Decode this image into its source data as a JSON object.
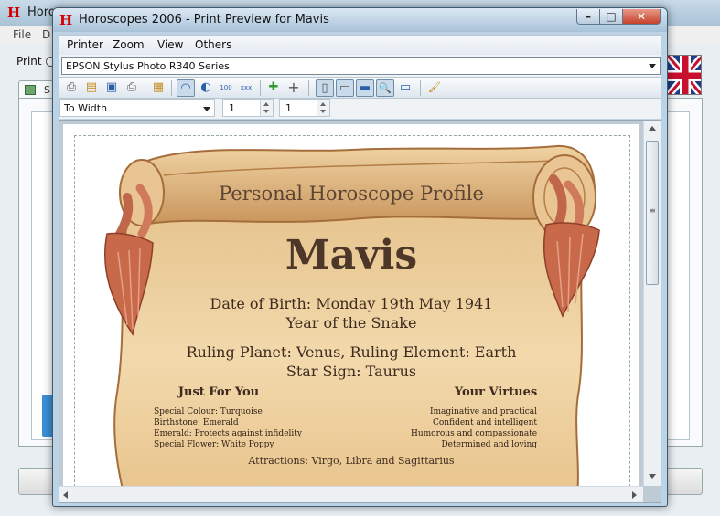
{
  "background_window": {
    "title": "Horo",
    "menu": [
      "File",
      "D"
    ],
    "print_label": "Print",
    "tab_label": "S"
  },
  "window": {
    "title": "Horoscopes 2006 - Print Preview for Mavis",
    "app_logo": "H",
    "controls": {
      "minimize": "–",
      "maximize": "□",
      "close": "✕"
    }
  },
  "menubar": [
    "Printer",
    "Zoom",
    "View",
    "Others"
  ],
  "printer": {
    "selected": "EPSON Stylus Photo R340 Series"
  },
  "toolbar": {
    "buttons": [
      {
        "icon": "print-icon",
        "glyph": "⎙"
      },
      {
        "icon": "export-image-icon",
        "glyph": "▤"
      },
      {
        "icon": "bmp-icon",
        "glyph": "▣"
      },
      {
        "icon": "printer-setup-icon",
        "glyph": "⎙"
      },
      {
        "icon": "page-setup-icon",
        "glyph": "▦"
      },
      {
        "icon": "page-view-icon",
        "glyph": "◠"
      },
      {
        "icon": "zoom-page-icon",
        "glyph": "◐"
      },
      {
        "icon": "zoom-100-icon",
        "glyph": "100"
      },
      {
        "icon": "zoom-custom-icon",
        "glyph": "xxx"
      },
      {
        "icon": "zoom-in-icon",
        "glyph": "✚"
      },
      {
        "icon": "add-icon",
        "glyph": "+"
      },
      {
        "icon": "single-page-icon",
        "glyph": "▯"
      },
      {
        "icon": "two-page-icon",
        "glyph": "▭"
      },
      {
        "icon": "wide-page-icon",
        "glyph": "▬"
      },
      {
        "icon": "magnifier-icon",
        "glyph": "🔍"
      },
      {
        "icon": "fit-icon",
        "glyph": "▭"
      },
      {
        "icon": "paint-roller-icon",
        "glyph": "🖌"
      }
    ]
  },
  "zoom": {
    "mode": "To Width",
    "page_from": "1",
    "page_to": "1"
  },
  "document": {
    "heading": "Personal Horoscope Profile",
    "name": "Mavis",
    "dob": "Date of Birth: Monday 19th May 1941",
    "year": "Year of the Snake",
    "ruling": "Ruling Planet: Venus, Ruling Element: Earth",
    "star_sign": "Star Sign: Taurus",
    "just_for_you": {
      "title": "Just For You",
      "items": [
        "Special Colour: Turquoise",
        "Birthstone: Emerald",
        "Emerald: Protects against infidelity",
        "Special Flower: White Poppy"
      ]
    },
    "your_virtues": {
      "title": "Your Virtues",
      "items": [
        "Imaginative and practical",
        "Confident and intelligent",
        "Humorous and compassionate",
        "Determined and loving"
      ]
    },
    "attractions": "Attractions: Virgo, Libra and Sagittarius"
  },
  "colors": {
    "parchment": "#eed0a0",
    "parchment_dark": "#c8955c",
    "rope": "#c0664a",
    "title_red": "#d40000"
  }
}
